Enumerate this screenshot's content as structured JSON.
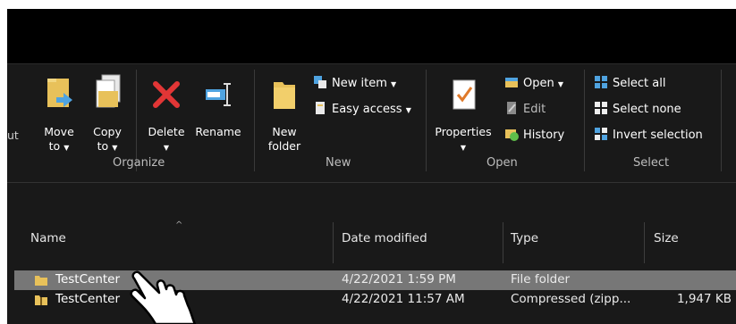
{
  "ribbon": {
    "cut_partial": "ut",
    "organize": {
      "label": "Organize",
      "move": {
        "line1": "Move",
        "line2": "to"
      },
      "copy": {
        "line1": "Copy",
        "line2": "to"
      },
      "delete": "Delete",
      "rename": "Rename"
    },
    "new": {
      "label": "New",
      "new_folder": {
        "line1": "New",
        "line2": "folder"
      },
      "new_item": "New item",
      "easy_access": "Easy access"
    },
    "open": {
      "label": "Open",
      "properties": "Properties",
      "open": "Open",
      "edit": "Edit",
      "history": "History"
    },
    "select": {
      "label": "Select",
      "select_all": "Select all",
      "select_none": "Select none",
      "invert_selection": "Invert selection"
    }
  },
  "file_list": {
    "columns": {
      "name": "Name",
      "date_modified": "Date modified",
      "type": "Type",
      "size": "Size"
    },
    "rows": [
      {
        "name": "TestCenter",
        "date": "4/22/2021 1:59 PM",
        "type": "File folder",
        "size": "",
        "icon": "folder-icon",
        "selected": true
      },
      {
        "name": "TestCenter",
        "date": "4/22/2021 11:57 AM",
        "type": "Compressed (zipp...",
        "size": "1,947 KB",
        "icon": "zip-folder-icon",
        "selected": false
      }
    ]
  },
  "colors": {
    "background": "#191919",
    "selected_row": "#777777",
    "accent_blue": "#4fa3e0",
    "delete_red": "#e23636",
    "folder_yellow": "#e8c15a"
  }
}
